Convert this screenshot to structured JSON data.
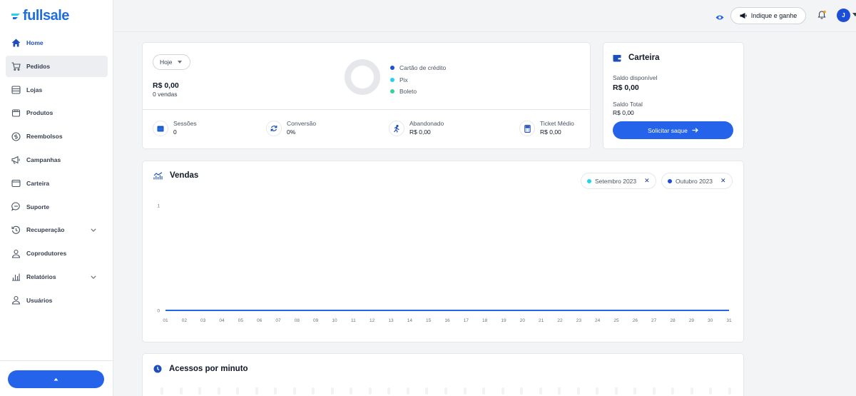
{
  "brand": {
    "name": "fullsale",
    "color": "#1e6ee0"
  },
  "sidebar": {
    "items": [
      {
        "label": "Home",
        "icon": "home-icon"
      },
      {
        "label": "Pedidos",
        "icon": "cart-icon"
      },
      {
        "label": "Lojas",
        "icon": "store-icon"
      },
      {
        "label": "Produtos",
        "icon": "box-icon"
      },
      {
        "label": "Reembolsos",
        "icon": "dollar-circle-icon"
      },
      {
        "label": "Campanhas",
        "icon": "megaphone-icon"
      },
      {
        "label": "Carteira",
        "icon": "wallet-icon"
      },
      {
        "label": "Suporte",
        "icon": "chat-icon"
      },
      {
        "label": "Recuperação",
        "icon": "history-icon",
        "expandable": true
      },
      {
        "label": "Coprodutores",
        "icon": "users-icon"
      },
      {
        "label": "Relatórios",
        "icon": "bar-chart-icon",
        "expandable": true
      },
      {
        "label": "Usuários",
        "icon": "user-icon"
      }
    ]
  },
  "topbar": {
    "refer_label": "Indique e ganhe",
    "avatar_initial": "J"
  },
  "summary": {
    "period": "Hoje",
    "amount": "R$ 0,00",
    "sales_count": "0 vendas",
    "legend": [
      {
        "label": "Cartão de crédito",
        "color": "#1d4ed8"
      },
      {
        "label": "Pix",
        "color": "#22d3ee"
      },
      {
        "label": "Boleto",
        "color": "#34d399"
      }
    ],
    "metrics": [
      {
        "label": "Sessões",
        "value": "0",
        "icon": "browser-icon"
      },
      {
        "label": "Conversão",
        "value": "0%",
        "icon": "refresh-icon"
      },
      {
        "label": "Abandonado",
        "value": "R$ 0,00",
        "icon": "running-person-icon"
      },
      {
        "label": "Ticket Médio",
        "value": "R$ 0,00",
        "icon": "calculator-icon"
      }
    ]
  },
  "wallet": {
    "title": "Carteira",
    "available_label": "Saldo disponível",
    "available_value": "R$ 0,00",
    "total_label": "Saldo Total",
    "total_value": "R$ 0,00",
    "withdraw_label": "Solicitar saque"
  },
  "sales": {
    "title": "Vendas",
    "filters": [
      {
        "label": "Setembro 2023",
        "color": "#22d3ee"
      },
      {
        "label": "Outubro 2023",
        "color": "#1d4ed8"
      }
    ]
  },
  "chart_data": {
    "type": "line",
    "categories": [
      "01",
      "02",
      "03",
      "04",
      "05",
      "06",
      "07",
      "08",
      "09",
      "10",
      "11",
      "12",
      "13",
      "14",
      "15",
      "16",
      "17",
      "18",
      "19",
      "20",
      "21",
      "22",
      "23",
      "24",
      "25",
      "26",
      "27",
      "28",
      "29",
      "30",
      "31"
    ],
    "series": [
      {
        "name": "Setembro 2023",
        "color": "#22d3ee",
        "values": [
          0,
          0,
          0,
          0,
          0,
          0,
          0,
          0,
          0,
          0,
          0,
          0,
          0,
          0,
          0,
          0,
          0,
          0,
          0,
          0,
          0,
          0,
          0,
          0,
          0,
          0,
          0,
          0,
          0,
          0,
          0
        ]
      },
      {
        "name": "Outubro 2023",
        "color": "#2563eb",
        "values": [
          0,
          0,
          0,
          0,
          0,
          0,
          0,
          0,
          0,
          0,
          0,
          0,
          0,
          0,
          0,
          0,
          0,
          0,
          0,
          0,
          0,
          0,
          0,
          0,
          0,
          0,
          0,
          0,
          0,
          0,
          0
        ]
      }
    ],
    "y_ticks": [
      "0",
      "1"
    ],
    "ylim": [
      0,
      1
    ],
    "grid": false
  },
  "access": {
    "title": "Acessos por minuto"
  }
}
